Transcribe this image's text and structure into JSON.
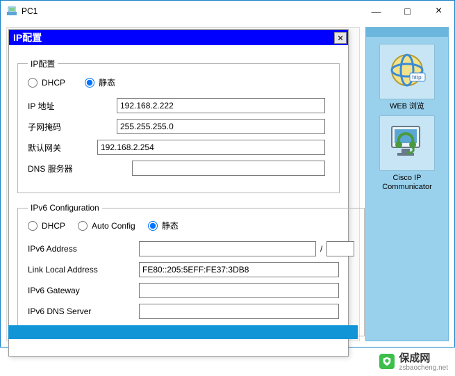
{
  "window": {
    "title": "PC1",
    "controls": {
      "min": "—",
      "max": "□",
      "close": "×"
    }
  },
  "dialog": {
    "title": "IP配置",
    "close": "×"
  },
  "ipv4": {
    "legend": "IP配置",
    "dhcp_label": "DHCP",
    "static_label": "静态",
    "selected": "static",
    "ip_label": "IP 地址",
    "ip_value": "192.168.2.222",
    "mask_label": "子网掩码",
    "mask_value": "255.255.255.0",
    "gateway_label": "默认网关",
    "gateway_value": "192.168.2.254",
    "dns_label": "DNS 服务器",
    "dns_value": ""
  },
  "ipv6": {
    "legend": "IPv6 Configuration",
    "dhcp_label": "DHCP",
    "auto_label": "Auto Config",
    "static_label": "静态",
    "selected": "static",
    "addr_label": "IPv6 Address",
    "addr_value": "",
    "prefix_value": "",
    "slash": "/",
    "link_local_label": "Link Local Address",
    "link_local_value": "FE80::205:5EFF:FE37:3DB8",
    "gateway_label": "IPv6 Gateway",
    "gateway_value": "",
    "dns_label": "IPv6 DNS Server",
    "dns_value": ""
  },
  "sidebar": {
    "items": [
      {
        "name": "web-browser",
        "label": "WEB 浏览"
      },
      {
        "name": "cisco-ip-communicator",
        "label": "Cisco IP Communicator"
      }
    ]
  },
  "watermark": {
    "text": "保成网",
    "sub": "zsbaocheng.net"
  }
}
